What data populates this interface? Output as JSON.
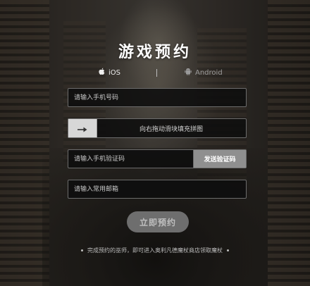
{
  "title": "游戏预约",
  "platforms": {
    "ios": {
      "label": "iOS",
      "icon": "apple-icon",
      "active": true
    },
    "android": {
      "label": "Android",
      "icon": "android-icon",
      "active": false
    }
  },
  "form": {
    "phone_placeholder": "请输入手机号码",
    "slider_hint": "向右拖动滑块填充拼图",
    "slider_icon": "arrow-right-icon",
    "sms_placeholder": "请输入手机验证码",
    "send_code_label": "发送验证码",
    "email_placeholder": "请输入常用邮箱",
    "submit_label": "立即预约"
  },
  "note": "完成预约的巫师，即可进入奥利凡德魔杖商店领取魔杖",
  "colors": {
    "background": "#1b1a19",
    "field_bg": "#0e0e0e",
    "field_border": "#6c6c6c",
    "send_button_bg": "#8f8f8f",
    "submit_bg": "#6e6e6e",
    "title": "#ffffff"
  }
}
